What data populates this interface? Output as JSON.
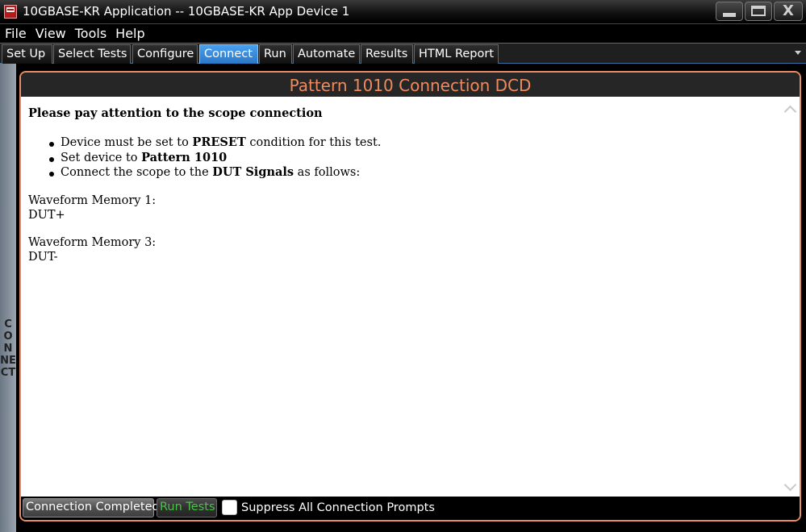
{
  "window": {
    "title": "10GBASE-KR Application -- 10GBASE-KR App Device 1",
    "close_glyph": "X"
  },
  "menu": {
    "items": [
      {
        "label": "File"
      },
      {
        "label": "View"
      },
      {
        "label": "Tools"
      },
      {
        "label": "Help"
      }
    ]
  },
  "tabs": {
    "items": [
      {
        "label": "Set Up"
      },
      {
        "label": "Select Tests"
      },
      {
        "label": "Configure"
      },
      {
        "label": "Connect"
      },
      {
        "label": "Run"
      },
      {
        "label": "Automate"
      },
      {
        "label": "Results"
      },
      {
        "label": "HTML Report"
      }
    ],
    "active": "Connect"
  },
  "side_label": "CONNECT",
  "panel": {
    "title": "Pattern 1010 Connection DCD",
    "heading": "Please pay attention to the scope connection",
    "bullet1": {
      "pre": "Device must be set to ",
      "bold": "PRESET",
      "post": " condition for this test."
    },
    "bullet2": {
      "pre": "Set device to ",
      "bold": "Pattern 1010"
    },
    "bullet3": {
      "pre": "Connect the scope to the ",
      "bold": "DUT Signals",
      "post": " as follows:"
    },
    "wf1": {
      "label": "Waveform Memory 1:",
      "signal": "DUT+"
    },
    "wf3": {
      "label": "Waveform Memory 3:",
      "signal": "DUT-"
    }
  },
  "footer": {
    "completed_label": "Connection Completed",
    "run_label": "Run Tests",
    "suppress_label": "Suppress All Connection Prompts",
    "suppress_checked": false
  },
  "colors": {
    "accent_orange": "#f08a5c",
    "active_tab": "#3a8ee0",
    "run_text": "#49c449"
  }
}
